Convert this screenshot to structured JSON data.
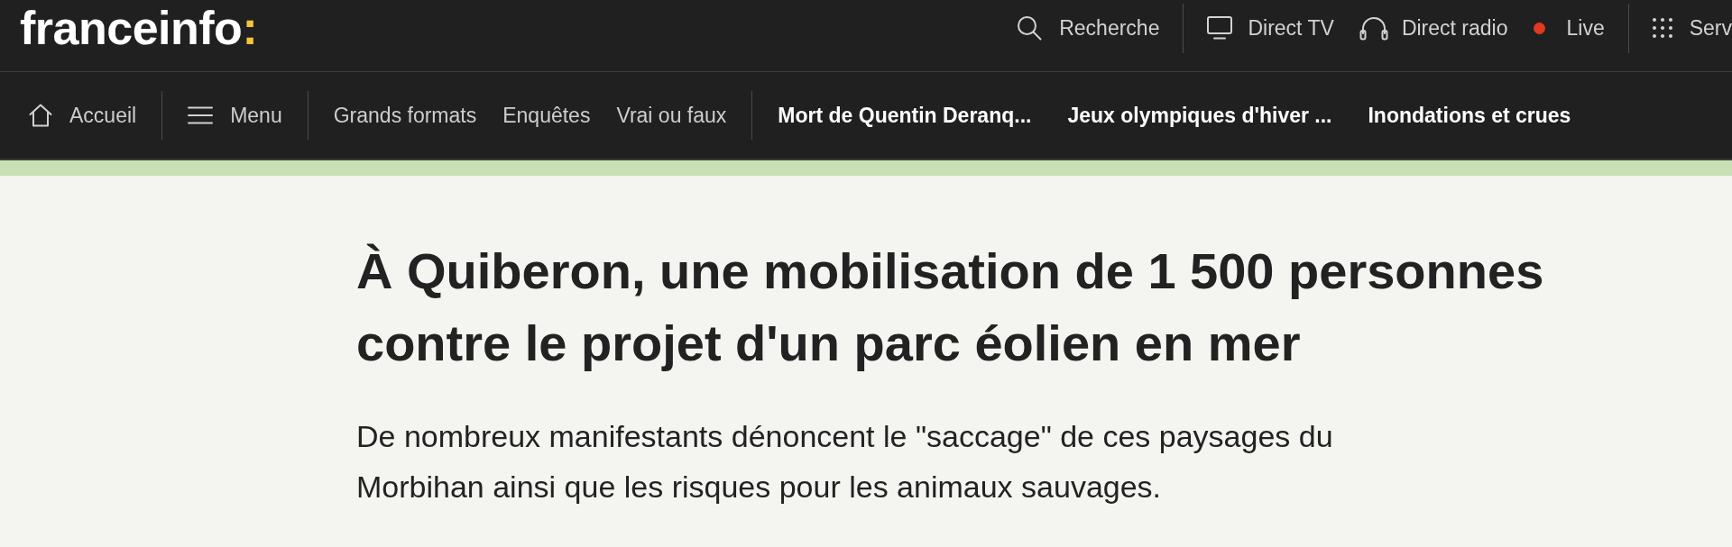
{
  "header": {
    "logo": {
      "name": "franceinfo",
      "accent": ":"
    },
    "utility_groups": [
      [
        {
          "kind": "search",
          "label": "Recherche"
        }
      ],
      [
        {
          "kind": "tv",
          "label": "Direct TV"
        },
        {
          "kind": "radio",
          "label": "Direct radio"
        },
        {
          "kind": "live",
          "label": "Live"
        }
      ],
      [
        {
          "kind": "services",
          "label": "Serv"
        }
      ]
    ]
  },
  "nav": {
    "groups": [
      [
        {
          "kind": "home",
          "label": "Accueil"
        }
      ],
      [
        {
          "kind": "menu",
          "label": "Menu"
        }
      ],
      [
        {
          "kind": "section",
          "label": "Grands formats"
        },
        {
          "kind": "section",
          "label": "Enquêtes"
        },
        {
          "kind": "section",
          "label": "Vrai ou faux"
        }
      ],
      [
        {
          "kind": "topic",
          "label": "Mort de Quentin Deranq..."
        },
        {
          "kind": "topic",
          "label": "Jeux olympiques d'hiver ..."
        },
        {
          "kind": "topic",
          "label": "Inondations et crues"
        }
      ]
    ]
  },
  "article": {
    "title": "À Quiberon, une mobilisation de 1 500 personnes contre le projet d'un parc éolien en mer",
    "lead": "De nombreux manifestants dénoncent le \"saccage\" de ces paysages du Morbihan ainsi que les risques pour les animaux sauvages."
  }
}
